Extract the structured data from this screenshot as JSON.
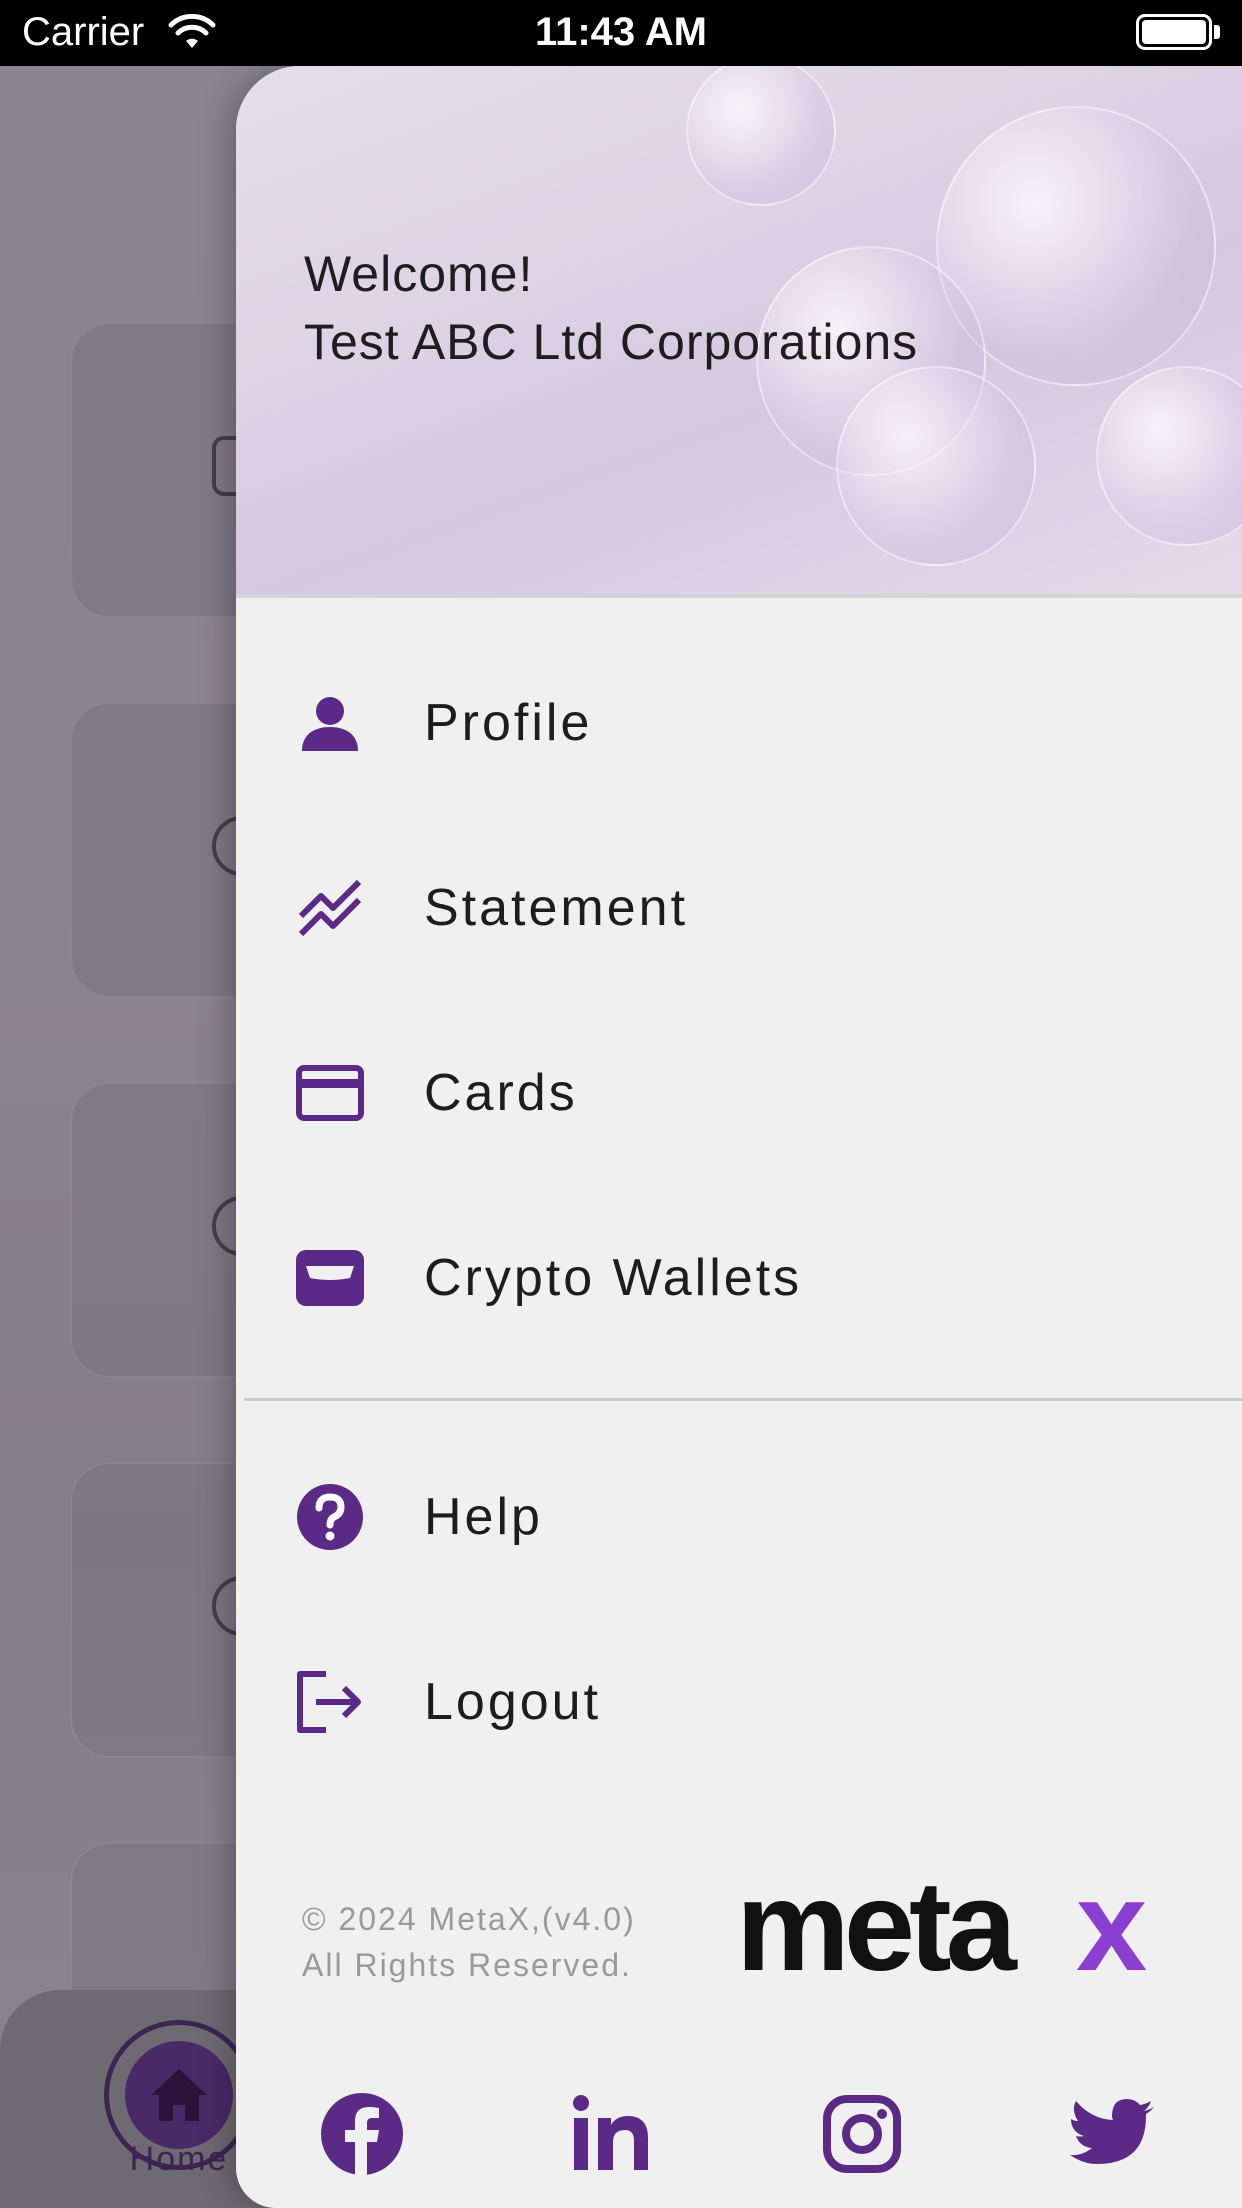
{
  "status_bar": {
    "carrier": "Carrier",
    "time": "11:43 AM"
  },
  "background": {
    "nav": {
      "home_label": "Home"
    }
  },
  "drawer": {
    "welcome_line1": "Welcome!",
    "welcome_line2": "Test ABC Ltd Corporations",
    "menu_primary": [
      {
        "label": "Profile",
        "icon": "person-icon"
      },
      {
        "label": "Statement",
        "icon": "chart-trend-icon"
      },
      {
        "label": "Cards",
        "icon": "credit-card-icon"
      },
      {
        "label": "Crypto Wallets",
        "icon": "wallet-icon"
      }
    ],
    "menu_secondary": [
      {
        "label": "Help",
        "icon": "help-icon"
      },
      {
        "label": "Logout",
        "icon": "logout-icon"
      }
    ],
    "footer": {
      "copyright_line1": "© 2024 MetaX,(v4.0)",
      "copyright_line2": "All Rights Reserved.",
      "logo_text": "meta",
      "logo_x": "x"
    },
    "social": [
      "facebook-icon",
      "linkedin-icon",
      "instagram-icon",
      "twitter-icon"
    ]
  },
  "colors": {
    "accent": "#5b2a86",
    "logo_purple": "#8a3fd1",
    "drawer_bg": "#f0f0f0",
    "text": "#1d1d1d",
    "muted": "#9a9a9a"
  }
}
